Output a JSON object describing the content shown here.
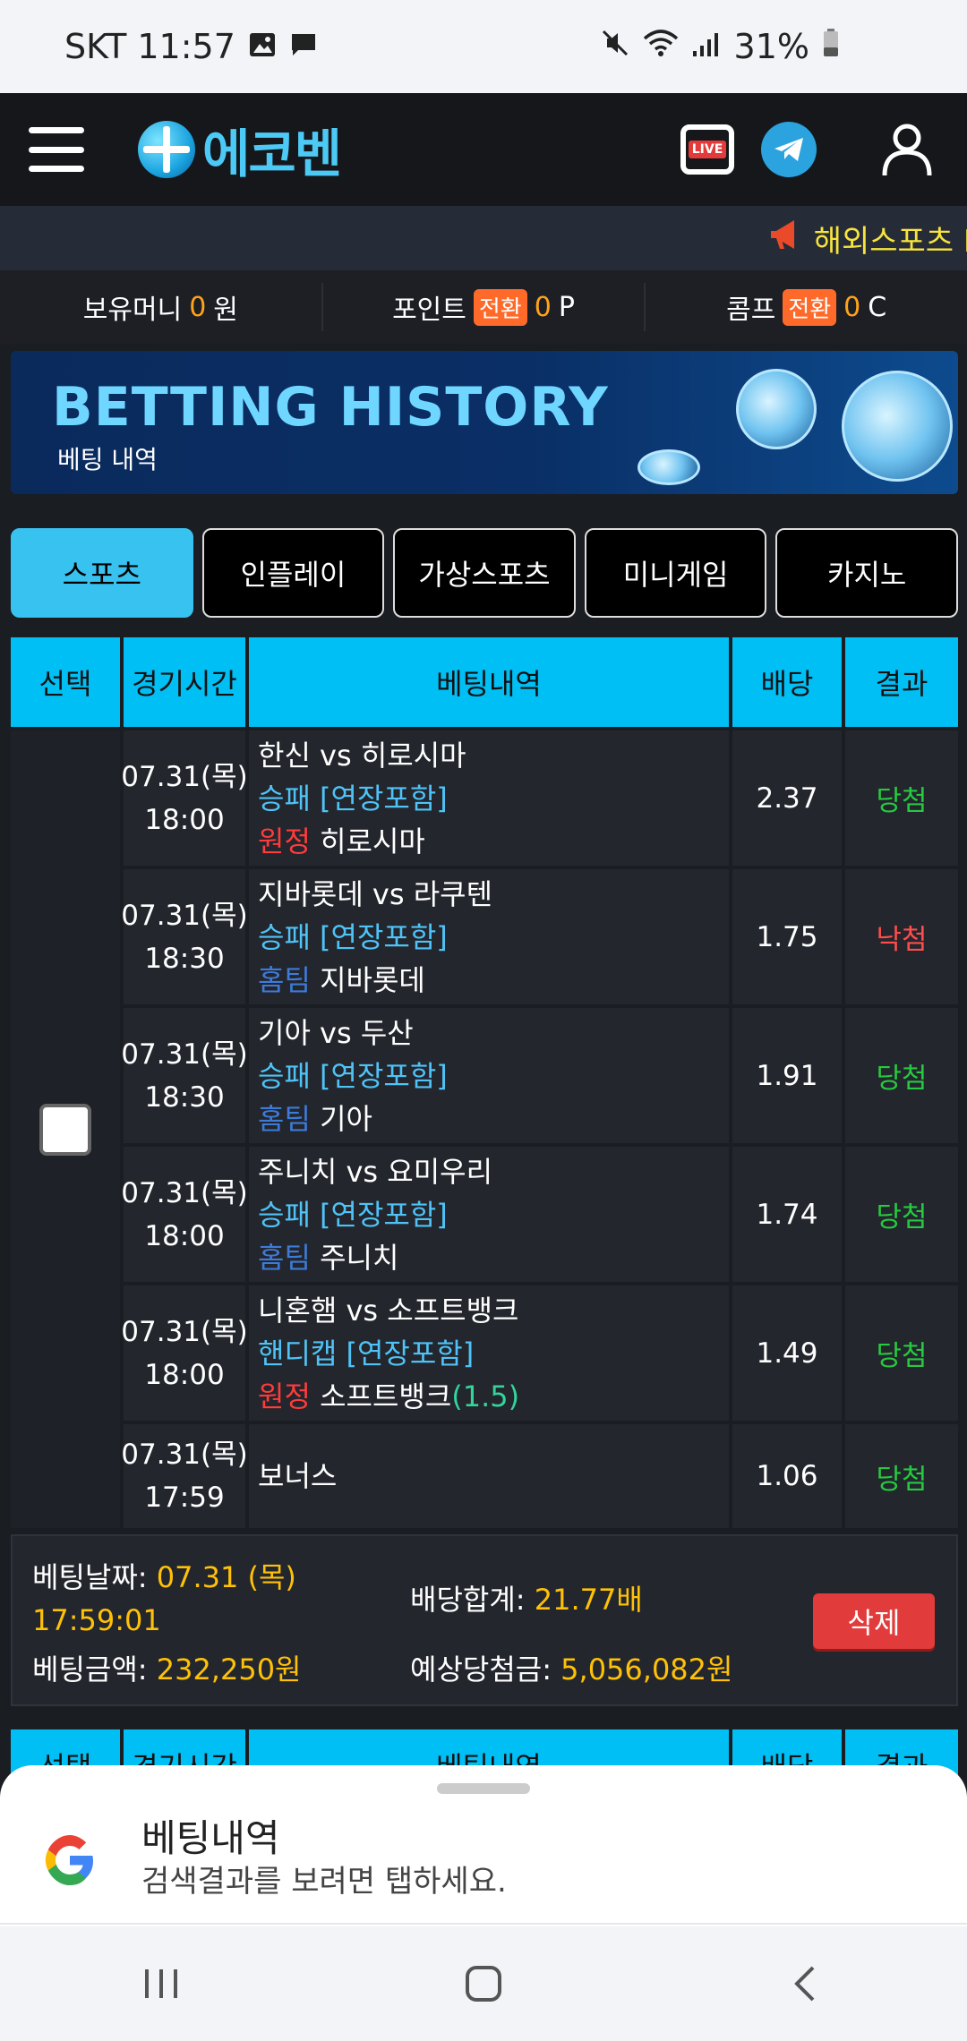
{
  "status": {
    "time": "SKT 11:57",
    "battery": "31%"
  },
  "header": {
    "logo_text": "에코벤",
    "live_label": "LIVE"
  },
  "ticker": {
    "text": "해외스포츠 BT"
  },
  "wallet": {
    "money_label": "보유머니",
    "money_value": "0",
    "money_unit": "원",
    "point_label": "포인트",
    "point_switch": "전환",
    "point_value": "0",
    "point_unit": "P",
    "comp_label": "콤프",
    "comp_switch": "전환",
    "comp_value": "0",
    "comp_unit": "C"
  },
  "banner": {
    "title": "BETTING HISTORY",
    "subtitle": "베팅 내역"
  },
  "tabs": [
    "스포츠",
    "인플레이",
    "가상스포츠",
    "미니게임",
    "카지노"
  ],
  "table": {
    "headers": [
      "선택",
      "경기시간",
      "베팅내역",
      "배당",
      "결과"
    ],
    "rows": [
      {
        "date": "07.31(목)",
        "time": "18:00",
        "match": "한신 vs 히로시마",
        "market": "승패 [연장포함]",
        "side": "원정",
        "pick": "히로시마",
        "handicap": "",
        "odds": "2.37",
        "result": "당첨"
      },
      {
        "date": "07.31(목)",
        "time": "18:30",
        "match": "지바롯데 vs 라쿠텐",
        "market": "승패 [연장포함]",
        "side": "홈팀",
        "pick": "지바롯데",
        "handicap": "",
        "odds": "1.75",
        "result": "낙첨"
      },
      {
        "date": "07.31(목)",
        "time": "18:30",
        "match": "기아 vs 두산",
        "market": "승패 [연장포함]",
        "side": "홈팀",
        "pick": "기아",
        "handicap": "",
        "odds": "1.91",
        "result": "당첨"
      },
      {
        "date": "07.31(목)",
        "time": "18:00",
        "match": "주니치 vs 요미우리",
        "market": "승패 [연장포함]",
        "side": "홈팀",
        "pick": "주니치",
        "handicap": "",
        "odds": "1.74",
        "result": "당첨"
      },
      {
        "date": "07.31(목)",
        "time": "18:00",
        "match": "니혼햄 vs 소프트뱅크",
        "market": "핸디캡 [연장포함]",
        "side": "원정",
        "pick": "소프트뱅크",
        "handicap": "(1.5)",
        "odds": "1.49",
        "result": "당첨"
      },
      {
        "date": "07.31(목)",
        "time": "17:59",
        "match": "보너스",
        "market": "",
        "side": "",
        "pick": "",
        "handicap": "",
        "odds": "1.06",
        "result": "당첨"
      }
    ]
  },
  "summary": {
    "date_label": "베팅날짜:",
    "date_value": "07.31 (목)",
    "time_value": "17:59:01",
    "amount_label": "베팅금액:",
    "amount_value": "232,250원",
    "odds_label": "배당합계:",
    "odds_value": "21.77배",
    "payout_label": "예상당첨금:",
    "payout_value": "5,056,082원",
    "delete_label": "삭제"
  },
  "sheet": {
    "title": "베팅내역",
    "subtitle": "검색결과를 보려면 탭하세요."
  },
  "colors": {
    "accent": "#00bff5",
    "win": "#26c940",
    "loss": "#ff4d4d",
    "value": "#ffc107"
  }
}
